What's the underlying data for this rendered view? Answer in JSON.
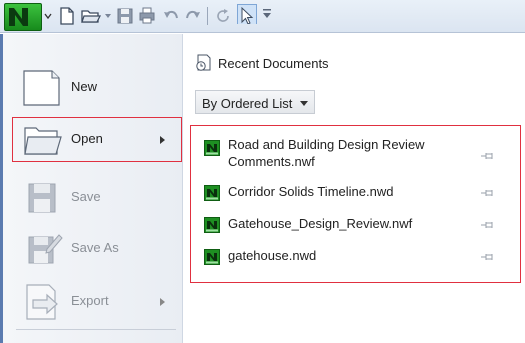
{
  "toolbar": {
    "app_button_letter": "N",
    "icons": [
      "new-file-icon",
      "open-folder-icon",
      "dropdown-icon",
      "save-icon",
      "print-icon",
      "undo-icon",
      "redo-icon",
      "refresh-icon",
      "select-cursor-icon",
      "customize-icon"
    ]
  },
  "menu": {
    "items": [
      {
        "label": "New",
        "icon": "new-document-icon",
        "enabled": true
      },
      {
        "label": "Open",
        "icon": "open-folder-icon",
        "enabled": true,
        "submenu": true
      },
      {
        "label": "Save",
        "icon": "save-disk-icon",
        "enabled": false
      },
      {
        "label": "Save As",
        "icon": "save-as-icon",
        "enabled": false
      },
      {
        "label": "Export",
        "icon": "export-icon",
        "enabled": false,
        "submenu": true
      }
    ]
  },
  "recent": {
    "title": "Recent Documents",
    "order_selected": "By Ordered List",
    "documents": [
      {
        "name": "Road and Building Design Review Comments.nwf"
      },
      {
        "name": "Corridor Solids Timeline.nwd"
      },
      {
        "name": "Gatehouse_Design_Review.nwf"
      },
      {
        "name": "gatehouse.nwd"
      }
    ]
  },
  "colors": {
    "highlight": "#e03040",
    "navisworks_green": "#1e8f22",
    "toolbar_bg": "#e3ebf5"
  }
}
